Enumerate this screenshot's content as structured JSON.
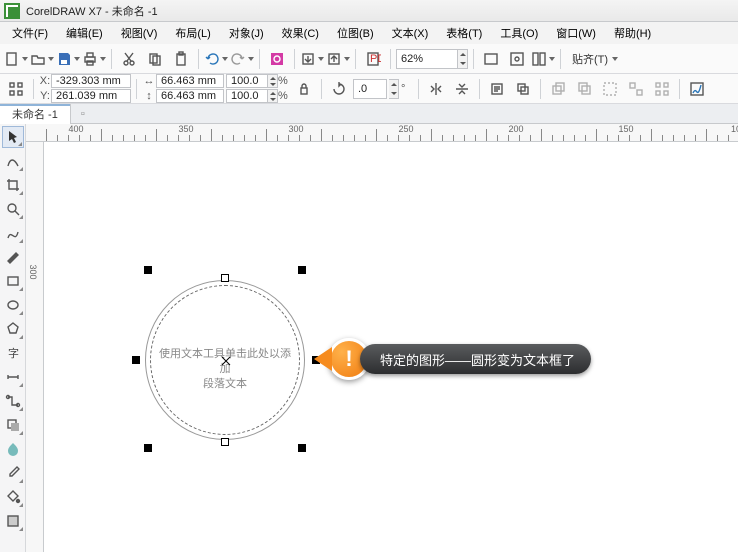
{
  "title": "CorelDRAW X7 - 未命名 -1",
  "menu": {
    "file": "文件(F)",
    "edit": "编辑(E)",
    "view": "视图(V)",
    "layout": "布局(L)",
    "object": "对象(J)",
    "effects": "效果(C)",
    "bitmap": "位图(B)",
    "text": "文本(X)",
    "table": "表格(T)",
    "tools": "工具(O)",
    "window": "窗口(W)",
    "help": "帮助(H)"
  },
  "toolbar1": {
    "zoom_value": "62%",
    "snap_label": "贴齐(T)"
  },
  "propbar": {
    "x_label": "X:",
    "x": "-329.303 mm",
    "y_label": "Y:",
    "y": "261.039 mm",
    "w": "66.463 mm",
    "h": "66.463 mm",
    "sx": "100.0",
    "sy": "100.0",
    "pct": "%",
    "rot": ".0",
    "deg": "°"
  },
  "doc_tab": "未命名 -1",
  "circle_hint_l1": "使用文本工具单击此处以添加",
  "circle_hint_l2": "段落文本",
  "callout_text": "特定的图形——圆形变为文本框了",
  "ruler_h": [
    "400",
    "350",
    "300",
    "250",
    "200",
    "150",
    "10"
  ],
  "ruler_v": [
    "300"
  ]
}
